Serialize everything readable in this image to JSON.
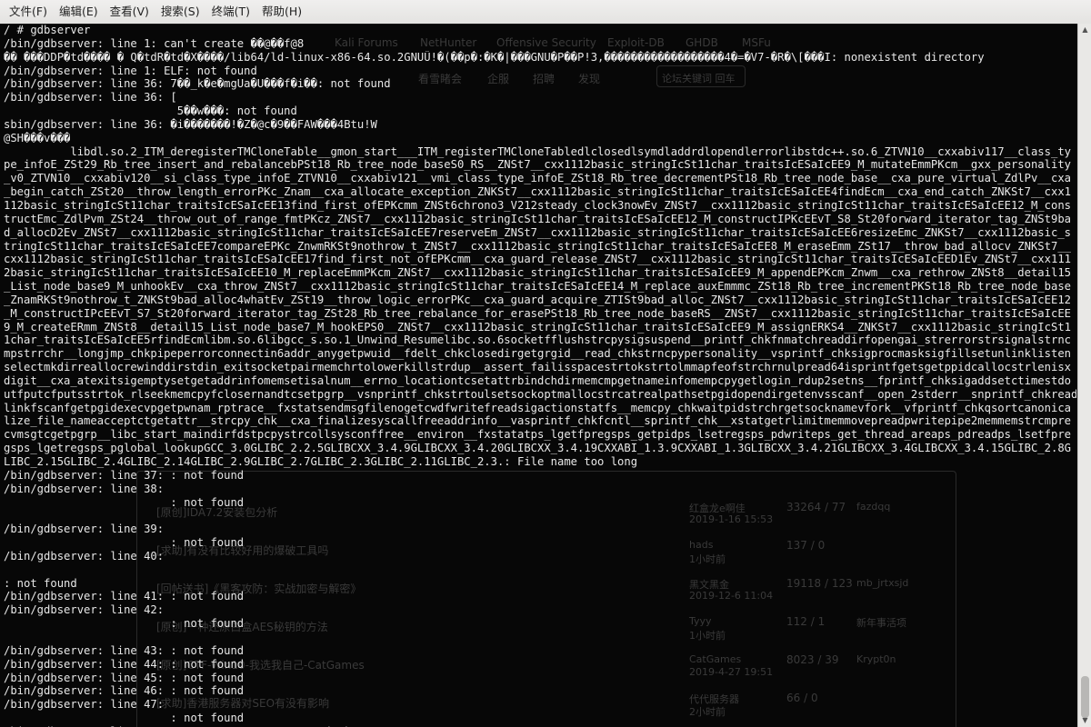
{
  "menu": [
    "文件(F)",
    "编辑(E)",
    "查看(V)",
    "搜索(S)",
    "终端(T)",
    "帮助(H)"
  ],
  "terminal": {
    "prompt": "/ # ",
    "lines": [
      "/ # gdbserver",
      "/bin/gdbserver: line 1: can't create ��@��f@8",
      "�� ���DDP�td���� � Q�tdR�td�X����/lib64/ld-linux-x86-64.so.2GNUÛ!�(��p�:�K�|���GNU�P��P!3,������������������4�=�V7-�R�\\[���I: nonexistent directory",
      "/bin/gdbserver: line 1: ELF: not found",
      "/bin/gdbserver: line 36: 7��_k�e�mgUa�U���f�i��: not found",
      "/bin/gdbserver: line 36: [",
      "                          5��w���: not found",
      "sbin/gdbserver: line 36: �i�������!�Z�@c�9��FAW���4Btu!W",
      "@SH���v���",
      "          libdl.so.2_ITM_deregisterTMCloneTable__gmon_start___ITM_registerTMCloneTabledlclosedlsymdladdrdlopendlerrorlibstdc++.so.6_ZTVN10__cxxabiv117__class_ty",
      "pe_infoE_ZSt29_Rb_tree_insert_and_rebalancebPSt18_Rb_tree_node_baseS0_RS__ZNSt7__cxx1112basic_stringIcSt11char_traitsIcESaIcEE9_M_mutateEmmPKcm__gxx_personality",
      "_v0_ZTVN10__cxxabiv120__si_class_type_infoE_ZTVN10__cxxabiv121__vmi_class_type_infoE_ZSt18_Rb_tree_decrementPSt18_Rb_tree_node_base__cxa_pure_virtual_ZdlPv__cxa",
      "_begin_catch_ZSt20__throw_length_errorPKc_Znam__cxa_allocate_exception_ZNKSt7__cxx1112basic_stringIcSt11char_traitsIcESaIcEE4findEcm__cxa_end_catch_ZNKSt7__cxx1",
      "112basic_stringIcSt11char_traitsIcESaIcEE13find_first_ofEPKcmm_ZNSt6chrono3_V212steady_clock3nowEv_ZNSt7__cxx1112basic_stringIcSt11char_traitsIcESaIcEE12_M_cons",
      "tructEmc_ZdlPvm_ZSt24__throw_out_of_range_fmtPKcz_ZNSt7__cxx1112basic_stringIcSt11char_traitsIcESaIcEE12_M_constructIPKcEEvT_S8_St20forward_iterator_tag_ZNSt9ba",
      "d_allocD2Ev_ZNSt7__cxx1112basic_stringIcSt11char_traitsIcESaIcEE7reserveEm_ZNSt7__cxx1112basic_stringIcSt11char_traitsIcESaIcEE6resizeEmc_ZNKSt7__cxx1112basic_s",
      "tringIcSt11char_traitsIcESaIcEE7compareEPKc_ZnwmRKSt9nothrow_t_ZNSt7__cxx1112basic_stringIcSt11char_traitsIcESaIcEE8_M_eraseEmm_ZSt17__throw_bad_allocv_ZNKSt7__",
      "cxx1112basic_stringIcSt11char_traitsIcESaIcEE17find_first_not_ofEPKcmm__cxa_guard_release_ZNSt7__cxx1112basic_stringIcSt11char_traitsIcESaIcEED1Ev_ZNSt7__cxx111",
      "2basic_stringIcSt11char_traitsIcESaIcEE10_M_replaceEmmPKcm_ZNSt7__cxx1112basic_stringIcSt11char_traitsIcESaIcEE9_M_appendEPKcm_Znwm__cxa_rethrow_ZNSt8__detail15",
      "_List_node_base9_M_unhookEv__cxa_throw_ZNSt7__cxx1112basic_stringIcSt11char_traitsIcESaIcEE14_M_replace_auxEmmmc_ZSt18_Rb_tree_incrementPKSt18_Rb_tree_node_base",
      "_ZnamRKSt9nothrow_t_ZNKSt9bad_alloc4whatEv_ZSt19__throw_logic_errorPKc__cxa_guard_acquire_ZTISt9bad_alloc_ZNSt7__cxx1112basic_stringIcSt11char_traitsIcESaIcEE12",
      "_M_constructIPcEEvT_S7_St20forward_iterator_tag_ZSt28_Rb_tree_rebalance_for_erasePSt18_Rb_tree_node_baseRS__ZNSt7__cxx1112basic_stringIcSt11char_traitsIcESaIcEE",
      "9_M_createERmm_ZNSt8__detail15_List_node_base7_M_hookEPS0__ZNSt7__cxx1112basic_stringIcSt11char_traitsIcESaIcEE9_M_assignERKS4__ZNKSt7__cxx1112basic_stringIcSt1",
      "1char_traitsIcESaIcEE5rfindEcmlibm.so.6libgcc_s.so.1_Unwind_Resumelibc.so.6socketfflushstrcpysigsuspend__printf_chkfnmatchreaddirfopengai_strerrorstrsignalstrnc",
      "mpstrrchr__longjmp_chkpipeperrorconnectin6addr_anygetpwuid__fdelt_chkclosedirgetgrgid__read_chkstrncpypersonality__vsprintf_chksigprocmasksigfillsetunlinklisten",
      "selectmkdirreallocrewinddirstdin_exitsocketpairmemchrtolowerkillstrdup__assert_failisspacestrtokstrtolmmapfeofstrchrnulpread64isprintfgetsgetppidcallocstrlenisx",
      "digit__cxa_atexitsigemptysetgetaddrinfomemsetisalnum__errno_locationtcsetattrbindchdirmemcmpgetnameinfomempcpygetlogin_rdup2setns__fprintf_chksigaddsetctimestdo",
      "utfputcfputsstrtok_rlseekmemcpyfclosernandtcsetpgrp__vsnprintf_chkstrtoulsetsockoptmallocstrcatrealpathsetpgidopendirgetenvsscanf__open_2stderr__snprintf_chkread",
      "linkfscanfgetpgidexecvpgetpwnam_rptrace__fxstatsendmsgfilenogetcwdfwritefreadsigactionstatfs__memcpy_chkwaitpidstrchrgetsocknamevfork__vfprintf_chkqsortcanonica",
      "lize_file_nameacceptctgetattr__strcpy_chk__cxa_finalizesyscallfreeaddrinfo__vasprintf_chkfcntl__sprintf_chk__xstatgetrlimitmemmovepreadpwritepipe2memmemstrcmpre",
      "cvmsgtcgetpgrp__libc_start_maindirfdstpcpystrcollsysconffree__environ__fxstatatps_lgetfpregsps_getpidps_lsetregsps_pdwriteps_get_thread_areaps_pdreadps_lsetfpre",
      "gsps_lgetregsps_pglobal_lookupGCC_3.0GLIBC_2.2.5GLIBCXX_3.4.9GLIBCXX_3.4.20GLIBCXX_3.4.19CXXABI_1.3.9CXXABI_1.3GLIBCXX_3.4.21GLIBCXX_3.4GLIBCXX_3.4.15GLIBC_2.8G",
      "LIBC_2.15GLIBC_2.4GLIBC_2.14GLIBC_2.9GLIBC_2.7GLIBC_2.3GLIBC_2.11GLIBC_2.3.: File name too long",
      "/bin/gdbserver: line 37: : not found",
      "/bin/gdbserver: line 38:",
      "                         : not found",
      "",
      "/bin/gdbserver: line 39:",
      "                         : not found",
      "/bin/gdbserver: line 40:",
      "",
      ": not found",
      "/bin/gdbserver: line 41: : not found",
      "/bin/gdbserver: line 42:",
      "                         : not found",
      "",
      "/bin/gdbserver: line 43: : not found",
      "/bin/gdbserver: line 44: : not found",
      "/bin/gdbserver: line 45: : not found",
      "/bin/gdbserver: line 46: : not found",
      "/bin/gdbserver: line 47:",
      "                         : not found",
      "/bin/gdbserver: line 48: syntax error: unexpected \")\""
    ]
  },
  "background_window": {
    "bookmarks": [
      "Kali Forums",
      "NetHunter",
      "Offensive Security",
      "Exploit-DB",
      "GHDB",
      "MSFu"
    ],
    "nav": [
      "看雪睹会",
      "企服",
      "招聘",
      "发现"
    ],
    "search_placeholder": "论坛关键词 回车",
    "threads": [
      {
        "title": "[原创]IDA7.2安装包分析",
        "tag": "",
        "stats": "33264 / 77"
      },
      {
        "title": "[求助]有没有比较好用的爆破工具吗",
        "tag": "",
        "stats": "137 / 0"
      },
      {
        "title": "[回帖送书]《黑客攻防：实战加密与解密》",
        "tag": "",
        "stats": "19118 / 123"
      },
      {
        "title": "[原创]一种还原白盒AES秘钥的方法",
        "tag": "",
        "stats": "112 / 1"
      },
      {
        "title": "[原创]CTF-Win10-我选我自己-CatGames",
        "tag": "",
        "stats": "8023 / 39"
      },
      {
        "title": "[求助]香港服务器对SEO有没有影响",
        "tag": "",
        "stats": "66 / 0"
      },
      {
        "title": "[原创]SQL注入获取用户名密码过程-integer型注入",
        "tag": "",
        "stats": "1783 / 6"
      }
    ],
    "authors": [
      "红盒龙e啊佳",
      "hads",
      "黑文黑金",
      "Tyyy",
      "CatGames",
      "代代服务器",
      "CCPS"
    ],
    "dates": [
      "2019-1-16 15:53",
      "1小时前",
      "2019-12-6 11:04",
      "1小时前",
      "2019-4-27 19:51",
      "2小时前",
      "2小时前"
    ],
    "last_posts": [
      "fazdqq",
      "",
      "mb_jrtxsjd",
      "新年事活项",
      "Krypt0n",
      "",
      "Krypt0n"
    ]
  }
}
